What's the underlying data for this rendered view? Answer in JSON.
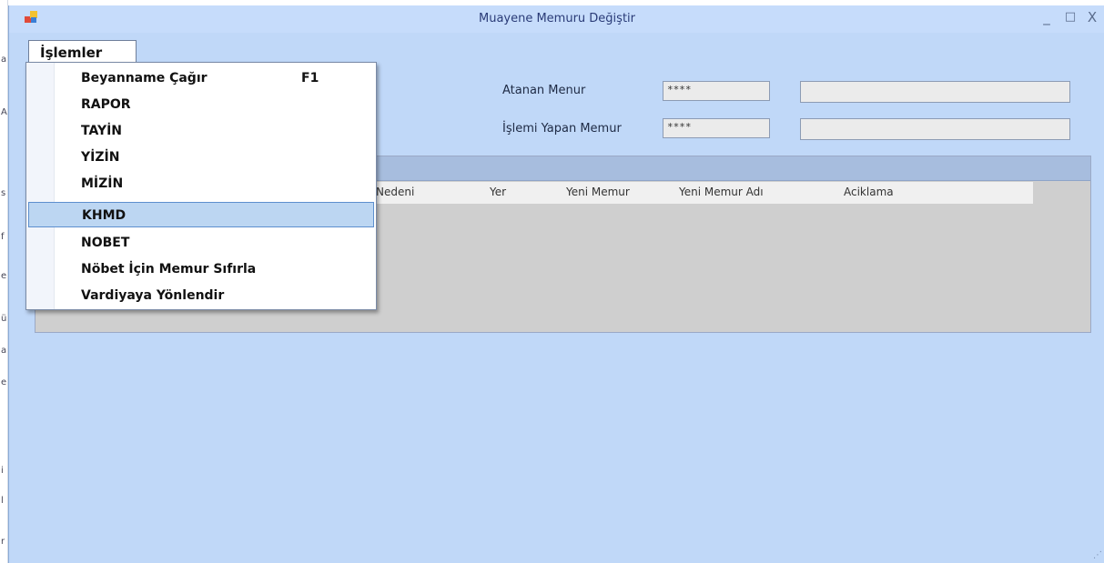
{
  "window": {
    "title": "Muayene Memuru Değiştir",
    "controls": {
      "minimize": "_",
      "maximize": "□",
      "close": "X"
    }
  },
  "menu": {
    "top_label": "İşlemler",
    "items": [
      {
        "label": "Beyanname Çağır",
        "shortcut": "F1",
        "highlighted": false
      },
      {
        "label": "RAPOR",
        "shortcut": "",
        "highlighted": false
      },
      {
        "label": "TAYİN",
        "shortcut": "",
        "highlighted": false
      },
      {
        "label": "YİZİN",
        "shortcut": "",
        "highlighted": false
      },
      {
        "label": "MİZİN",
        "shortcut": "",
        "highlighted": false
      },
      {
        "label": "KHMD",
        "shortcut": "",
        "highlighted": true
      },
      {
        "label": "NOBET",
        "shortcut": "",
        "highlighted": false
      },
      {
        "label": "Nöbet İçin Memur Sıfırla",
        "shortcut": "",
        "highlighted": false
      },
      {
        "label": "Vardiyaya Yönlendir",
        "shortcut": "",
        "highlighted": false
      }
    ]
  },
  "form": {
    "assigned_label": "Atanan Menur",
    "assigned_code": "****",
    "assigned_name": "",
    "operator_label": "İşlemi Yapan Memur",
    "operator_code": "****",
    "operator_name": ""
  },
  "grid": {
    "columns": [
      "Nedeni",
      "Yer",
      "Yeni Memur",
      "Yeni Memur Adı",
      "Aciklama"
    ]
  },
  "background_strip_chars": [
    "a",
    "A",
    "s",
    "f",
    "e",
    "ü",
    "a",
    "e",
    "i",
    "l",
    "r"
  ],
  "colors": {
    "window_bg": "#c0d8f8",
    "highlight": "#bcd6f2",
    "title_text": "#2a3b77"
  }
}
